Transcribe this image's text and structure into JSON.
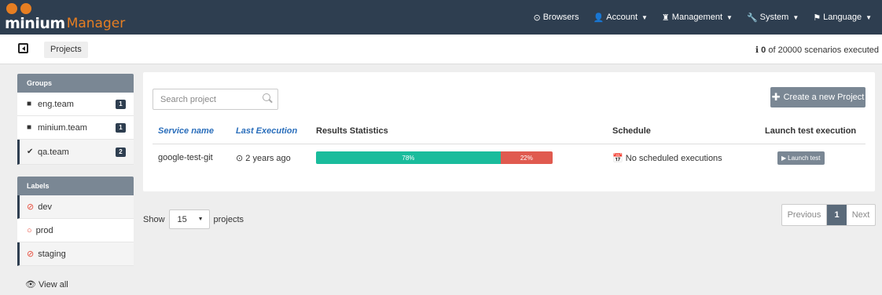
{
  "brand": {
    "name_main": "minium",
    "name_sub": "Manager"
  },
  "nav": {
    "browsers": "Browsers",
    "account": "Account",
    "management": "Management",
    "system": "System",
    "language": "Language"
  },
  "subheader": {
    "breadcrumb": "Projects",
    "executed_count": "0",
    "executed_text": "of 20000 scenarios executed"
  },
  "sidebar": {
    "groups_title": "Groups",
    "groups": [
      {
        "label": "eng.team",
        "count": "1"
      },
      {
        "label": "minium.team",
        "count": "1"
      },
      {
        "label": "qa.team",
        "count": "2"
      }
    ],
    "labels_title": "Labels",
    "labels": [
      {
        "label": "dev"
      },
      {
        "label": "prod"
      },
      {
        "label": "staging"
      }
    ],
    "view_all": "View all"
  },
  "main": {
    "search_placeholder": "Search project",
    "create_button": "Create a new Project",
    "columns": [
      "Service name",
      "Last Execution",
      "Results Statistics",
      "Schedule",
      "Launch test execution"
    ],
    "rows": [
      {
        "service": "google-test-git",
        "last_execution": "2 years ago",
        "passed_pct": 78,
        "failed_pct": 22,
        "passed_label": "78%",
        "failed_label": "22%",
        "schedule": "No scheduled executions",
        "launch": "Launch test"
      }
    ]
  },
  "pager": {
    "show_label": "Show",
    "page_size": "15",
    "items_label": "projects",
    "previous": "Previous",
    "current_page": "1",
    "next": "Next"
  },
  "colors": {
    "navbar": "#2e3e50",
    "brand_accent": "#e67e22",
    "passed": "#1abc9c",
    "failed": "#e05a4f",
    "link": "#2a6ebb"
  }
}
